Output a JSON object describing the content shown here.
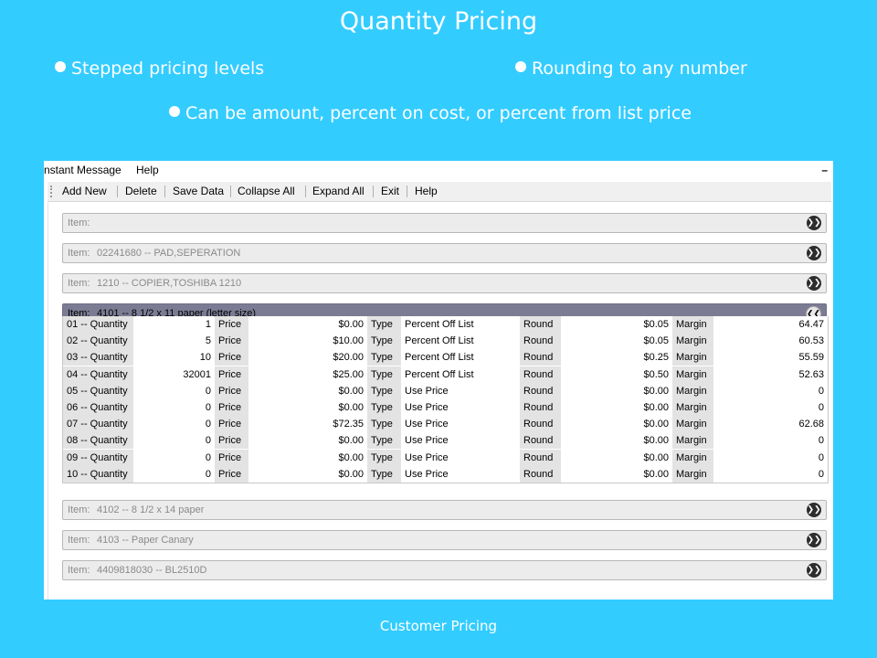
{
  "slide": {
    "title": "Quantity Pricing",
    "bullets": [
      "Stepped pricing levels",
      "Rounding to any number",
      "Can be amount, percent on cost, or percent from list price"
    ],
    "caption": "Customer Pricing"
  },
  "menubar": {
    "items": [
      "nstant Message",
      "Help"
    ],
    "minimize": "–"
  },
  "toolbar": {
    "buttons": [
      "Add New",
      "Delete",
      "Save Data",
      "Collapse All",
      "Expand All",
      "Exit",
      "Help"
    ]
  },
  "items_before": [
    {
      "label": "Item:",
      "desc": ""
    },
    {
      "label": "Item:",
      "desc": "02241680 -- PAD,SEPERATION"
    },
    {
      "label": "Item:",
      "desc": "1210 -- COPIER,TOSHIBA 1210"
    }
  ],
  "expanded_item": {
    "label": "Item:",
    "desc": "4101 -- 8 1/2 x 11 paper (letter size)"
  },
  "grid_labels": {
    "price": "Price",
    "type": "Type",
    "round": "Round",
    "margin": "Margin"
  },
  "levels": [
    {
      "qty_label": "01 -- Quantity",
      "qty": "1",
      "price": "$0.00",
      "type": "Percent Off List",
      "round": "$0.05",
      "margin": "64.47"
    },
    {
      "qty_label": "02 -- Quantity",
      "qty": "5",
      "price": "$10.00",
      "type": "Percent Off List",
      "round": "$0.05",
      "margin": "60.53"
    },
    {
      "qty_label": "03 -- Quantity",
      "qty": "10",
      "price": "$20.00",
      "type": "Percent Off List",
      "round": "$0.25",
      "margin": "55.59"
    },
    {
      "qty_label": "04 -- Quantity",
      "qty": "32001",
      "price": "$25.00",
      "type": "Percent Off List",
      "round": "$0.50",
      "margin": "52.63"
    },
    {
      "qty_label": "05 -- Quantity",
      "qty": "0",
      "price": "$0.00",
      "type": "Use Price",
      "round": "$0.00",
      "margin": "0"
    },
    {
      "qty_label": "06 -- Quantity",
      "qty": "0",
      "price": "$0.00",
      "type": "Use Price",
      "round": "$0.00",
      "margin": "0"
    },
    {
      "qty_label": "07 -- Quantity",
      "qty": "0",
      "price": "$72.35",
      "type": "Use Price",
      "round": "$0.00",
      "margin": "62.68"
    },
    {
      "qty_label": "08 -- Quantity",
      "qty": "0",
      "price": "$0.00",
      "type": "Use Price",
      "round": "$0.00",
      "margin": "0"
    },
    {
      "qty_label": "09 -- Quantity",
      "qty": "0",
      "price": "$0.00",
      "type": "Use Price",
      "round": "$0.00",
      "margin": "0"
    },
    {
      "qty_label": "10 -- Quantity",
      "qty": "0",
      "price": "$0.00",
      "type": "Use Price",
      "round": "$0.00",
      "margin": "0"
    }
  ],
  "items_after": [
    {
      "label": "Item:",
      "desc": "4102 -- 8 1/2 x 14 paper"
    },
    {
      "label": "Item:",
      "desc": "4103 -- Paper Canary"
    },
    {
      "label": "Item:",
      "desc": "4409818030 -- BL2510D"
    }
  ],
  "icons": {
    "collapsed": "chevron-double-down-icon",
    "expanded": "chevron-double-up-icon"
  },
  "colors": {
    "background": "#33CCFF",
    "expanded_header": "#7b7b94"
  }
}
